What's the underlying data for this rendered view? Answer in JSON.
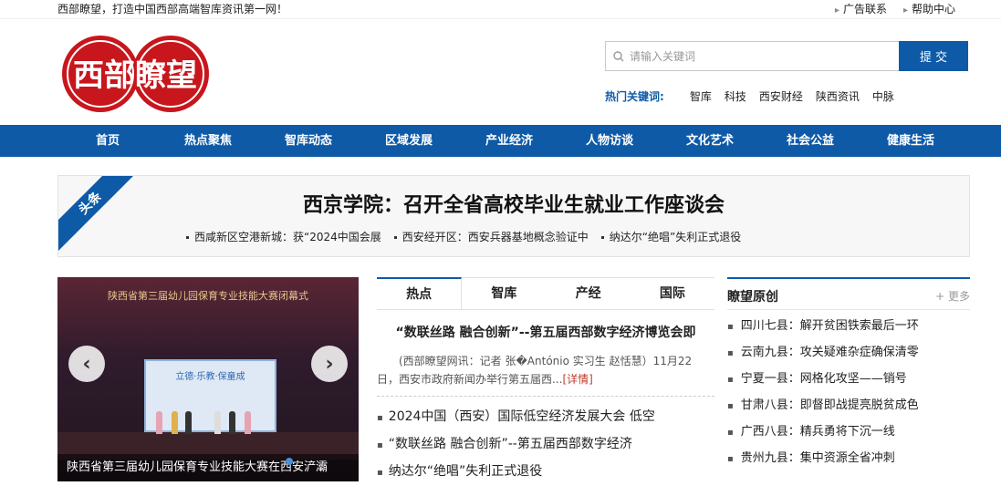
{
  "topbar": {
    "slogan": "西部瞭望，打造中国西部高端智库资讯第一网！",
    "links": [
      "广告联系",
      "帮助中心"
    ]
  },
  "logo": {
    "text": "西部瞭望",
    "color": "#c8161d"
  },
  "search": {
    "placeholder": "请输入关键词",
    "button": "提 交",
    "icon": "search-icon"
  },
  "hot_keywords": {
    "label": "热门关键词:",
    "items": [
      "智库",
      "科技",
      "西安财经",
      "陕西资讯",
      "中脉"
    ]
  },
  "nav": [
    "首页",
    "热点聚焦",
    "智库动态",
    "区域发展",
    "产业经济",
    "人物访谈",
    "文化艺术",
    "社会公益",
    "健康生活"
  ],
  "headline": {
    "ribbon": "头条",
    "title": "西京学院：召开全省高校毕业生就业工作座谈会",
    "subs": [
      "西咸新区空港新城：获“2024中国会展",
      "西安经开区：西安兵器基地概念验证中",
      "纳达尔“绝唱”失利正式退役"
    ]
  },
  "slider": {
    "banner": "陕西省第三届幼儿园保育专业技能大赛闭幕式",
    "stage_text": "立德·乐教·保童成",
    "caption": "陕西省第三届幼儿园保育专业技能大赛在西安浐灞",
    "prev": "‹",
    "next": "›"
  },
  "tabs": {
    "labels": [
      "热点",
      "智库",
      "产经",
      "国际"
    ],
    "featured_title": "“数联丝路 融合创新”--第五届西部数字经济博览会即",
    "summary": "(西部瞭望网讯：记者 张�António 实习生 赵恬慧）11月22日，西安市政府新闻办举行第五届西...",
    "more": "[详情]",
    "items": [
      "2024中国（西安）国际低空经济发展大会 低空",
      "“数联丝路 融合创新”--第五届西部数字经济",
      "纳达尔“绝唱”失利正式退役"
    ]
  },
  "original": {
    "title": "瞭望原创",
    "more": "+ 更多",
    "items": [
      "四川七县：解开贫困铁索最后一环",
      "云南九县：攻关疑难杂症确保清零",
      "宁夏一县：网格化攻坚——销号",
      "甘肃八县：即督即战提亮脱贫成色",
      "广西八县：精兵勇将下沉一线",
      "贵州九县：集中资源全省冲刺"
    ]
  }
}
